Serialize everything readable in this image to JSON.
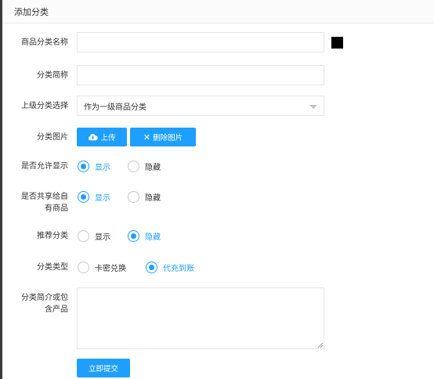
{
  "header": {
    "title": "添加分类"
  },
  "form": {
    "name_label": "商品分类名称",
    "name_value": "",
    "short_label": "分类简称",
    "short_value": "",
    "parent_label": "上级分类选择",
    "parent_selected": "作为一级商品分类",
    "image_label": "分类图片",
    "upload_label": "上传",
    "delete_label": "删除图片",
    "allow_label": "是否允许显示",
    "share_label_1": "是否共享给自",
    "share_label_2": "有商品",
    "recommend_label": "推荐分类",
    "type_label": "分类类型",
    "desc_label_1": "分类简介或包",
    "desc_label_2": "含产品",
    "desc_value": "",
    "submit_label": "立即提交"
  },
  "options": {
    "show": "显示",
    "hide": "隐藏",
    "card_exchange": "卡密兑换",
    "direct_recharge": "代充到账"
  },
  "state": {
    "allow_display": "显示",
    "share_products": "显示",
    "recommend": "隐藏",
    "category_type": "代充到账"
  },
  "colors": {
    "accent": "#1e9fff",
    "swatch": "#000000"
  },
  "icons": {
    "upload": "cloud-upload-icon",
    "delete": "close-icon",
    "select": "caret-down-icon"
  }
}
